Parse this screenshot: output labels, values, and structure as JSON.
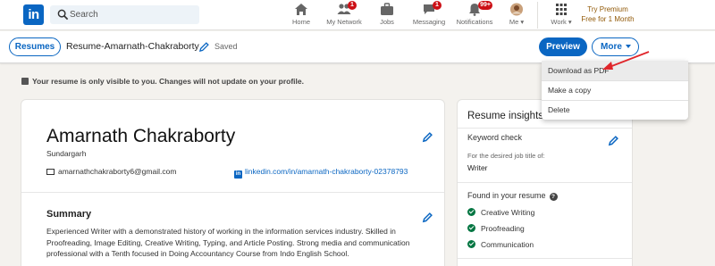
{
  "nav": {
    "logo_text": "in",
    "search_placeholder": "Search",
    "items": [
      {
        "label": "Home",
        "icon": "home-icon"
      },
      {
        "label": "My Network",
        "icon": "network-icon",
        "badge": "1"
      },
      {
        "label": "Jobs",
        "icon": "briefcase-icon"
      },
      {
        "label": "Messaging",
        "icon": "message-icon",
        "badge": "1"
      },
      {
        "label": "Notifications",
        "icon": "bell-icon",
        "badge": "99+"
      },
      {
        "label": "Me",
        "icon": "avatar"
      },
      {
        "label": "Work",
        "icon": "grid-icon"
      }
    ],
    "premium": "Try Premium Free for 1 Month"
  },
  "toolbar": {
    "resumes_label": "Resumes",
    "resume_name": "Resume-Amarnath-Chakraborty",
    "saved_label": "Saved",
    "preview_label": "Preview",
    "more_label": "More"
  },
  "dropdown": {
    "items": [
      "Download as PDF",
      "Make a copy",
      "Delete"
    ]
  },
  "notice": "Your resume is only visible to you. Changes will not update on your profile.",
  "profile": {
    "name": "Amarnath Chakraborty",
    "location": "Sundargarh",
    "email": "amarnathchakraborty6@gmail.com",
    "linkedin": "linkedin.com/in/amarnath-chakraborty-02378793"
  },
  "summary": {
    "title": "Summary",
    "text": "Experienced Writer with a demonstrated history of working in the information services industry. Skilled in Proofreading, Image Editing, Creative Writing, Typing, and Article Posting. Strong media and communication professional with a Tenth focused in Doing Accountancy Course from Indo English School."
  },
  "insights": {
    "title": "Resume insights",
    "keyword_check": "Keyword check",
    "job_title_label": "For the desired job title of:",
    "job_title": "Writer",
    "found_title": "Found in your resume",
    "found_items": [
      "Creative Writing",
      "Proofreading",
      "Communication"
    ]
  },
  "colors": {
    "brand": "#0a66c2",
    "badge": "#cc1016",
    "premium": "#915907",
    "check": "#057642",
    "arrow": "#e0262b"
  }
}
